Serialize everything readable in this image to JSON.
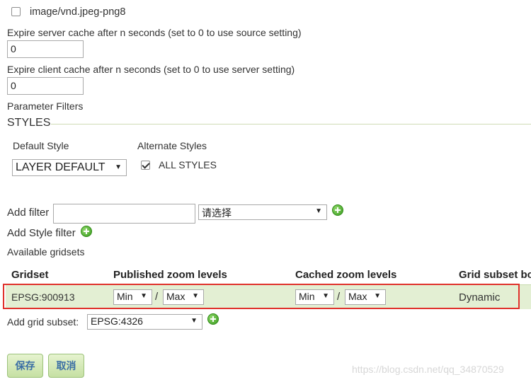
{
  "format_option": {
    "label": "image/vnd.jpeg-png8",
    "checked": false
  },
  "server_cache": {
    "label": "Expire server cache after n seconds (set to 0 to use source setting)",
    "value": "0"
  },
  "client_cache": {
    "label": "Expire client cache after n seconds (set to 0 to use server setting)",
    "value": "0"
  },
  "parameter_filters_label": "Parameter Filters",
  "styles": {
    "heading": "STYLES",
    "default_style_label": "Default Style",
    "default_style_value": "LAYER DEFAULT",
    "alternate_styles_label": "Alternate Styles",
    "all_styles_label": "ALL STYLES",
    "all_styles_checked": true
  },
  "add_filter": {
    "label": "Add filter",
    "value": "",
    "select_value": "请选择"
  },
  "add_style_filter_label": "Add Style filter",
  "available_gridsets_label": "Available gridsets",
  "gridsets_table": {
    "headers": [
      "Gridset",
      "Published zoom levels",
      "Cached zoom levels",
      "Grid subset bo"
    ],
    "rows": [
      {
        "gridset": "EPSG:900913",
        "pub_min": "Min",
        "pub_max": "Max",
        "cache_min": "Min",
        "cache_max": "Max",
        "subset_bounds": "Dynamic"
      }
    ],
    "separator": "/"
  },
  "add_grid_subset": {
    "label": "Add grid subset:",
    "value": "EPSG:4326"
  },
  "buttons": {
    "save": "保存",
    "cancel": "取消"
  },
  "watermark": "https://blog.csdn.net/qq_34870529",
  "colors": {
    "highlight_border": "#e0312b",
    "row_background": "#e3efd3",
    "plus_icon": "#3a9b1f",
    "button_text": "#3a6ea5"
  },
  "icons": {
    "add": "plus-circle-icon",
    "dropdown": "chevron-down-icon",
    "checkbox": "checkbox-icon"
  }
}
